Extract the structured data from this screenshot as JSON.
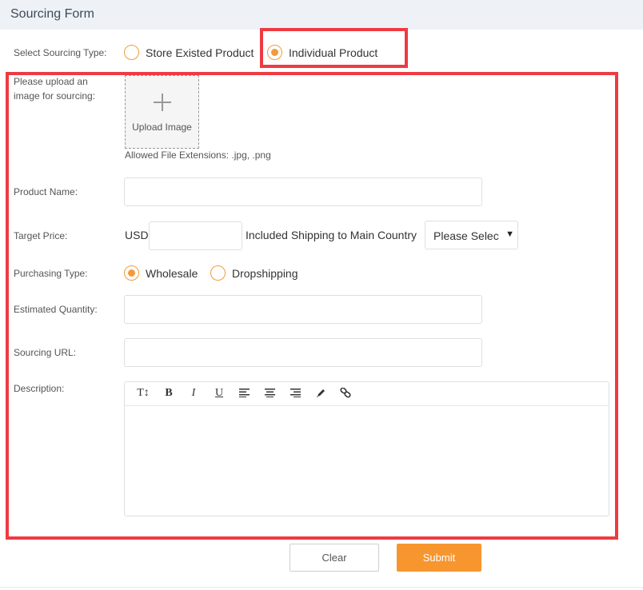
{
  "header": {
    "title": "Sourcing Form"
  },
  "sourcing_type": {
    "label": "Select Sourcing Type:",
    "options": [
      {
        "label": "Store Existed Product",
        "checked": false
      },
      {
        "label": "Individual Product",
        "checked": true
      }
    ]
  },
  "upload": {
    "label": "Please upload an image for sourcing:",
    "button_label": "Upload Image",
    "hint": "Allowed File Extensions: .jpg, .png"
  },
  "product_name": {
    "label": "Product Name:",
    "value": ""
  },
  "target_price": {
    "label": "Target Price:",
    "currency": "USD",
    "value": "",
    "shipping_text": "Included Shipping to Main Country",
    "select_value": "Please Select"
  },
  "purchasing_type": {
    "label": "Purchasing Type:",
    "options": [
      {
        "label": "Wholesale",
        "checked": true
      },
      {
        "label": "Dropshipping",
        "checked": false
      }
    ]
  },
  "estimated_quantity": {
    "label": "Estimated Quantity:",
    "value": ""
  },
  "sourcing_url": {
    "label": "Sourcing URL:",
    "value": ""
  },
  "description": {
    "label": "Description:",
    "toolbar": {
      "font_size": "T↕",
      "bold": "B",
      "italic": "I",
      "underline": "U",
      "icons": [
        "font-size-icon",
        "bold-icon",
        "italic-icon",
        "underline-icon",
        "align-left-icon",
        "align-center-icon",
        "align-right-icon",
        "pen-icon",
        "link-icon"
      ]
    },
    "value": ""
  },
  "buttons": {
    "clear": "Clear",
    "submit": "Submit"
  },
  "colors": {
    "accent": "#f7962f",
    "highlight": "#ef3a42",
    "header_bg": "#eef2f7"
  }
}
